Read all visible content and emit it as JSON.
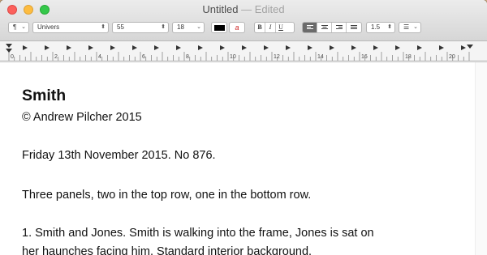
{
  "window": {
    "title": "Untitled",
    "separator": "—",
    "status": "Edited"
  },
  "toolbar": {
    "paragraph_style": "¶",
    "font_family": "Univers",
    "typeface": "55",
    "font_size": "18",
    "text_color": "#000000",
    "bold_label": "B",
    "italic_label": "I",
    "underline_label": "U",
    "alignment_selected": "left",
    "line_spacing": "1.5",
    "list_style": "list-icon"
  },
  "ruler": {
    "ticks": [
      "0",
      "2",
      "4",
      "6",
      "8",
      "10",
      "12",
      "14",
      "16",
      "18",
      "20"
    ]
  },
  "document": {
    "heading": "Smith",
    "copyright": "© Andrew Pilcher 2015",
    "dateline": "Friday 13th November 2015. No 876.",
    "panels": "Three panels, two in the top row, one in the bottom row.",
    "body_line1": "1. Smith and Jones. Smith is walking into the frame, Jones is sat on",
    "body_line2": "her haunches facing him. Standard interior background."
  },
  "colors": {
    "close": "#fc605c",
    "minimize": "#fdbc40",
    "maximize": "#34c84a"
  }
}
